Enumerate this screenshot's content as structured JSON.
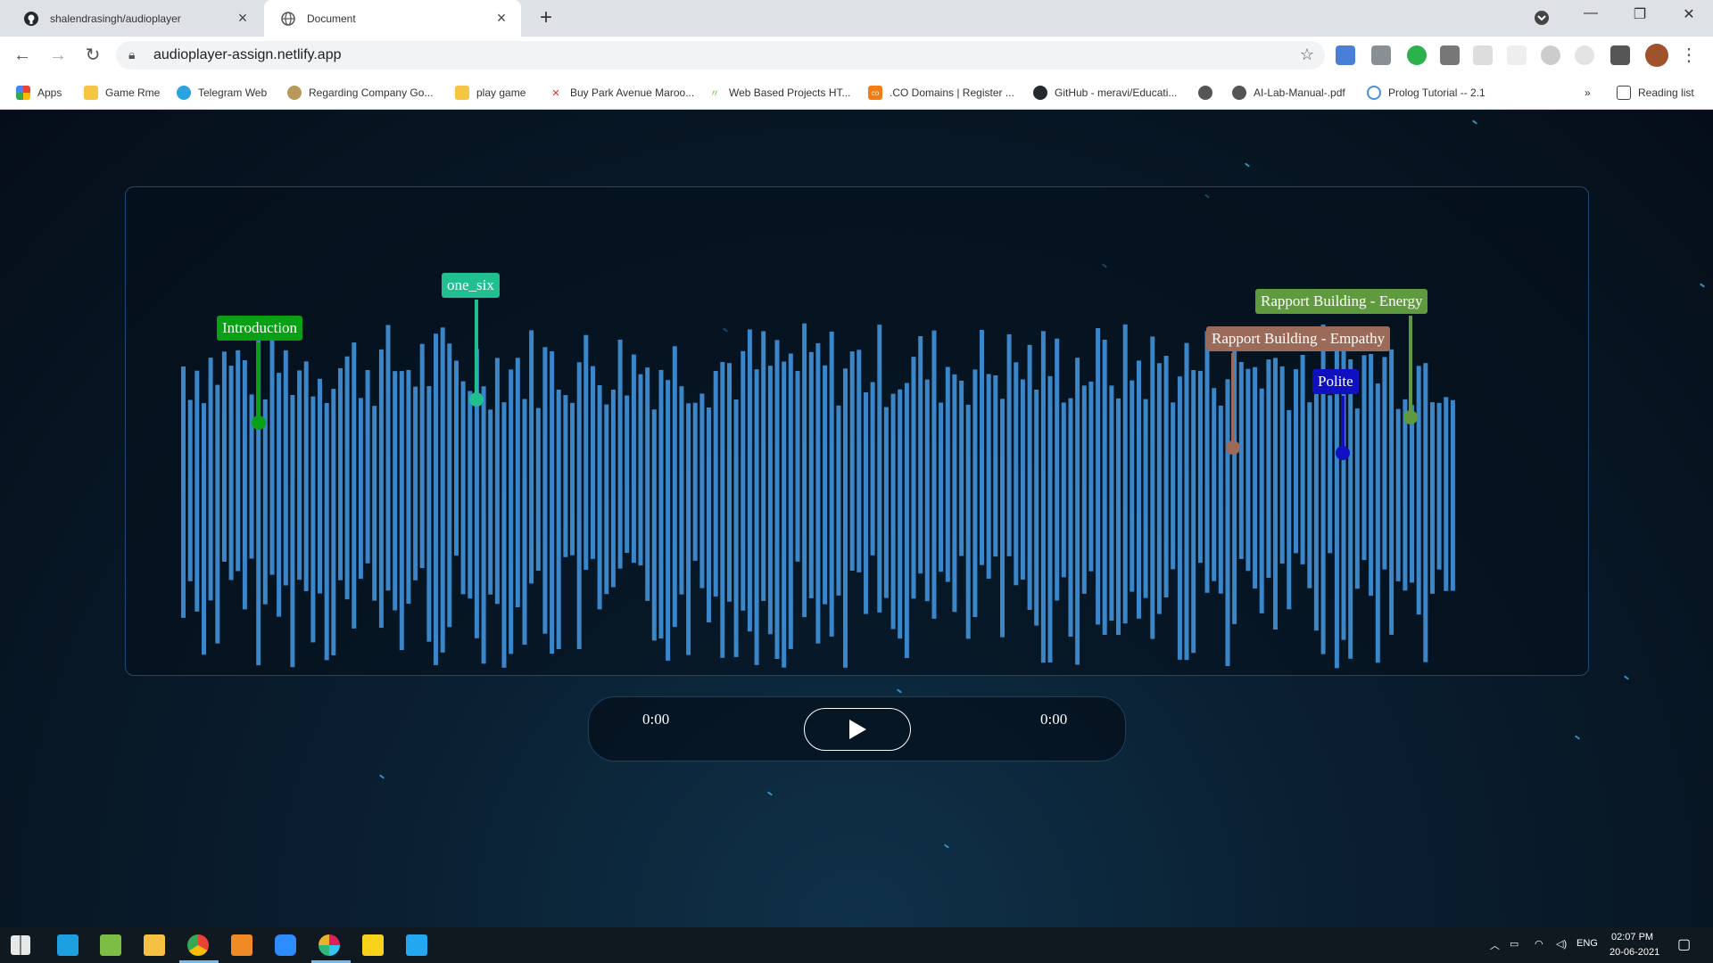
{
  "browser": {
    "tabs": [
      {
        "title": "shalendrasingh/audioplayer",
        "icon": "github-icon",
        "active": false
      },
      {
        "title": "Document",
        "icon": "globe-icon",
        "active": true
      }
    ],
    "url": "audioplayer-assign.netlify.app",
    "bookmarks": [
      {
        "label": "Apps",
        "icon": "apps-grid-icon"
      },
      {
        "label": "Game Rme",
        "icon": "folder-icon"
      },
      {
        "label": "Telegram Web",
        "icon": "telegram-icon"
      },
      {
        "label": "Regarding Company Go...",
        "icon": "seal-icon"
      },
      {
        "label": "play game",
        "icon": "folder-icon"
      },
      {
        "label": "Buy Park Avenue Maroo...",
        "icon": "x-icon"
      },
      {
        "label": "Web Based Projects HT...",
        "icon": "leaf-icon"
      },
      {
        "label": ".CO Domains | Register ...",
        "icon": "co-icon"
      },
      {
        "label": "GitHub - meravi/Educati...",
        "icon": "github-icon"
      },
      {
        "label": "",
        "icon": "globe-icon"
      },
      {
        "label": "AI-Lab-Manual-.pdf",
        "icon": "globe-icon"
      },
      {
        "label": "Prolog Tutorial -- 2.1",
        "icon": "circle-icon"
      }
    ],
    "reading_list": "Reading list",
    "more_bookmarks": "»"
  },
  "player": {
    "markers": [
      {
        "label": "Introduction",
        "color": "#0aa015"
      },
      {
        "label": "one_six",
        "color": "#1fbf8f"
      },
      {
        "label": "Rapport Building - Energy",
        "color": "#5f9a3e"
      },
      {
        "label": "Rapport Building - Empathy",
        "color": "#9b6a58"
      },
      {
        "label": "Polite",
        "color": "#1010c0"
      }
    ],
    "current_time": "0:00",
    "duration": "0:00",
    "play_icon": "play-icon",
    "bar_color": "#3a86c8"
  },
  "taskbar": {
    "language": "ENG",
    "time": "02:07 PM",
    "date": "20-06-2021"
  }
}
